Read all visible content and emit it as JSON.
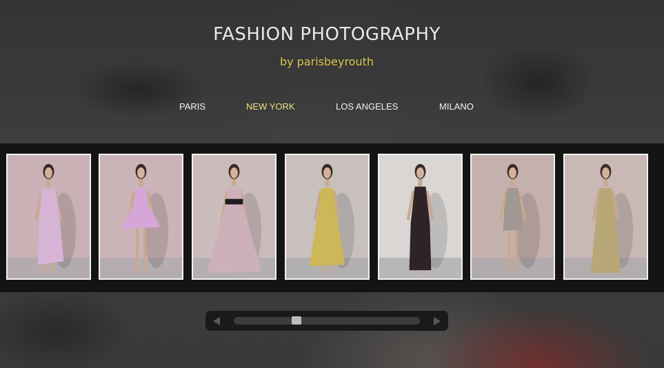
{
  "header": {
    "title": "FASHION PHOTOGRAPHY",
    "subtitle": "by parisbeyrouth"
  },
  "nav": {
    "items": [
      {
        "label": "PARIS",
        "active": false
      },
      {
        "label": "NEW YORK",
        "active": true
      },
      {
        "label": "LOS ANGELES",
        "active": false
      },
      {
        "label": "MILANO",
        "active": false
      }
    ],
    "active_color": "#efe283"
  },
  "gallery": {
    "thumbnails": [
      {
        "subject": "runway model in lilac draped gown",
        "dress_color": "#d7b3d6",
        "backdrop": "#c9b1b6"
      },
      {
        "subject": "runway model in pink ruffled cocktail dress",
        "dress_color": "#d6a6d8",
        "backdrop": "#cbb4b8"
      },
      {
        "subject": "runway model in pink tiered ball gown with black waistband",
        "dress_color": "#ceb0bb",
        "backdrop": "#cbbcbc"
      },
      {
        "subject": "runway model in yellow patterned halter gown",
        "dress_color": "#cdb759",
        "backdrop": "#c7c0bd"
      },
      {
        "subject": "runway model in black and white print maxi dress",
        "dress_color": "#2e2326",
        "backdrop": "#d9d6d4"
      },
      {
        "subject": "runway model in grey lace mini dress",
        "dress_color": "#a09892",
        "backdrop": "#c4b1ae"
      },
      {
        "subject": "runway model in gold embroidered gown",
        "dress_color": "#b8a877",
        "backdrop": "#c9b8b5"
      }
    ],
    "border_color": "#f2f2f2"
  },
  "scrollbar": {
    "position": 0.33,
    "left_icon": "arrow-left-icon",
    "right_icon": "arrow-right-icon"
  }
}
